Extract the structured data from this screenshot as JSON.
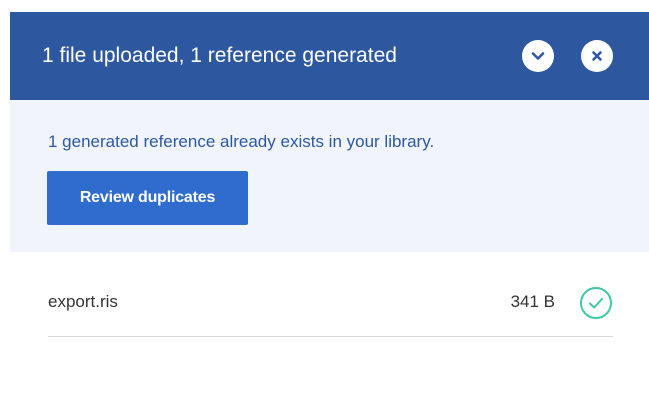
{
  "header": {
    "title": "1 file uploaded, 1 reference generated",
    "collapse_icon": "chevron-down-icon",
    "close_icon": "close-icon"
  },
  "notice": {
    "message": "1 generated reference already exists in your library.",
    "review_button_label": "Review duplicates"
  },
  "files": [
    {
      "name": "export.ris",
      "size": "341 B",
      "status_icon": "check-circle-icon"
    }
  ],
  "colors": {
    "header_bg": "#2d58a0",
    "notice_bg": "#f1f5fb",
    "notice_text": "#2d58a0",
    "button_bg": "#2f6ccd",
    "success": "#3ec7a8"
  }
}
